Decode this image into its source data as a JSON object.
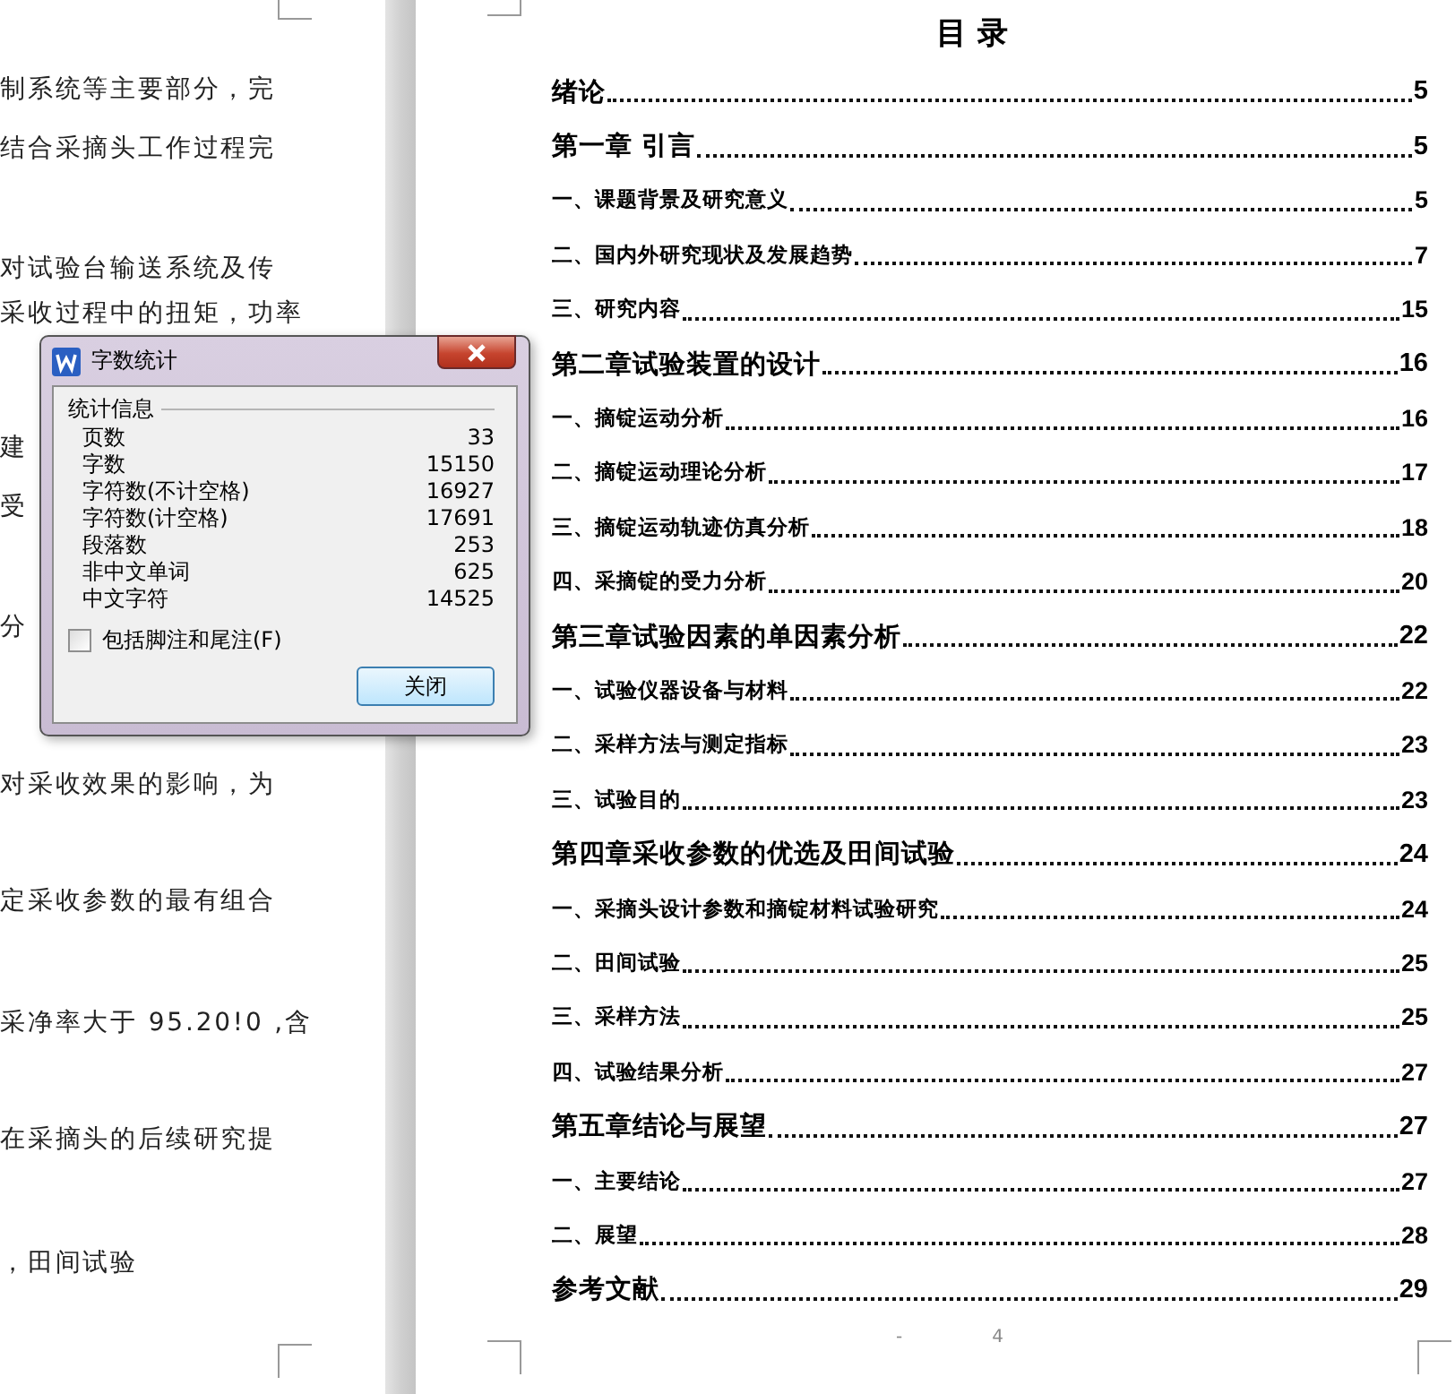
{
  "left_page": {
    "lines": [
      "制系统等主要部分，完",
      "结合采摘头工作过程完",
      "对试验台输送系统及传",
      "采收过程中的扭矩，功率",
      "建",
      "受",
      "分",
      "对采收效果的影响，为",
      "定采收参数的最有组合",
      "采净率大于 95.20!0 ,含",
      "在采摘头的后续研究提",
      "，田间试验"
    ]
  },
  "toc": {
    "title": "目 录",
    "entries": [
      {
        "kind": "chapter",
        "title": "绪论",
        "page": "5"
      },
      {
        "kind": "chapter",
        "title": "第一章 引言",
        "page": "5"
      },
      {
        "kind": "section",
        "title": "一、课题背景及研究意义",
        "page": "5"
      },
      {
        "kind": "section",
        "title": "二、国内外研究现状及发展趋势",
        "page": "7"
      },
      {
        "kind": "section",
        "title": "三、研究内容",
        "page": "15"
      },
      {
        "kind": "chapter",
        "title": "第二章试验装置的设计",
        "page": "16"
      },
      {
        "kind": "section",
        "title": "一、摘锭运动分析",
        "page": "16"
      },
      {
        "kind": "section",
        "title": "二、摘锭运动理论分析",
        "page": "17"
      },
      {
        "kind": "section",
        "title": "三、摘锭运动轨迹仿真分析",
        "page": "18"
      },
      {
        "kind": "section",
        "title": "四、采摘锭的受力分析",
        "page": "20"
      },
      {
        "kind": "chapter",
        "title": "第三章试验因素的单因素分析",
        "page": "22"
      },
      {
        "kind": "section",
        "title": "一、试验仪器设备与材料",
        "page": "22"
      },
      {
        "kind": "section",
        "title": "二、采样方法与测定指标",
        "page": "23"
      },
      {
        "kind": "section",
        "title": "三、试验目的",
        "page": "23"
      },
      {
        "kind": "chapter",
        "title": "第四章采收参数的优选及田间试验",
        "page": "24"
      },
      {
        "kind": "section",
        "title": "一、采摘头设计参数和摘锭材料试验研究",
        "page": "24"
      },
      {
        "kind": "section",
        "title": "二、田间试验",
        "page": "25"
      },
      {
        "kind": "section",
        "title": "三、采样方法",
        "page": "25"
      },
      {
        "kind": "section",
        "title": "四、试验结果分析",
        "page": "27"
      },
      {
        "kind": "chapter",
        "title": "第五章结论与展望",
        "page": "27"
      },
      {
        "kind": "section",
        "title": "一、主要结论",
        "page": "27"
      },
      {
        "kind": "section",
        "title": "二、展望",
        "page": "28"
      },
      {
        "kind": "chapter",
        "title": "参考文献",
        "page": "29"
      }
    ]
  },
  "footer": {
    "dash": "-",
    "page": "4"
  },
  "dialog": {
    "title": "字数统计",
    "group": "统计信息",
    "stats": [
      {
        "label": "页数",
        "value": "33"
      },
      {
        "label": "字数",
        "value": "15150"
      },
      {
        "label": "字符数(不计空格)",
        "value": "16927"
      },
      {
        "label": "字符数(计空格)",
        "value": "17691"
      },
      {
        "label": "段落数",
        "value": "253"
      },
      {
        "label": "非中文单词",
        "value": "625"
      },
      {
        "label": "中文字符",
        "value": "14525"
      }
    ],
    "checkbox": {
      "label": "包括脚注和尾注(F)",
      "checked": false
    },
    "button": "关闭"
  }
}
